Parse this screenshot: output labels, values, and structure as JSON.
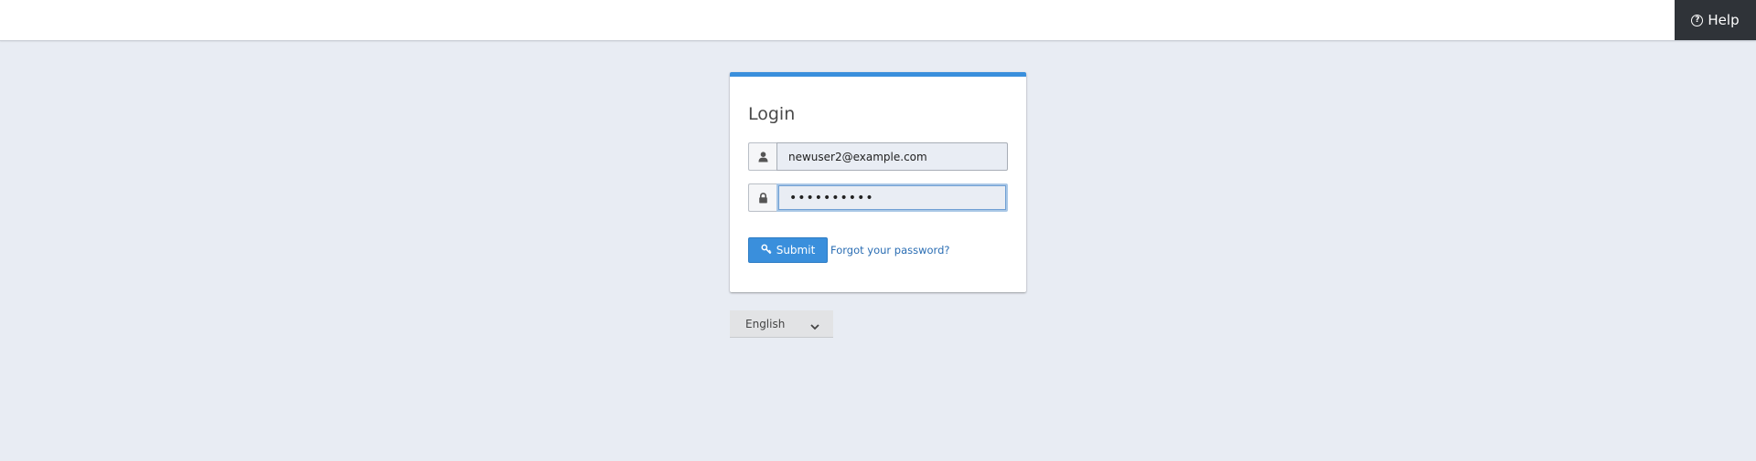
{
  "header": {
    "help_label": "Help"
  },
  "login": {
    "title": "Login",
    "email_value": "newuser2@example.com",
    "password_value": "••••••••••",
    "submit_label": "Submit",
    "forgot_label": "Forgot your password?"
  },
  "language": {
    "selected": "English"
  },
  "colors": {
    "accent": "#3a8fdc",
    "background": "#e8ecf3",
    "help_bg": "#2f3338",
    "link": "#2a6db3"
  },
  "icons": {
    "help": "question-circle-icon",
    "user": "user-icon",
    "lock": "lock-icon",
    "submit": "key-icon",
    "select": "chevron-down-icon"
  }
}
